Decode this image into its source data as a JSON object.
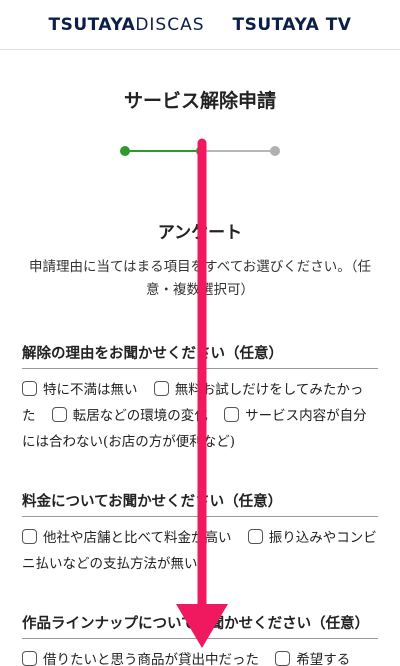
{
  "header": {
    "logo_discas_bold": "TSUTAYA",
    "logo_discas_thin": "DISCAS",
    "logo_tv": "TSUTAYA TV"
  },
  "page": {
    "title": "サービス解除申請"
  },
  "stepper": {
    "current_step": 2,
    "total_steps": 3,
    "colors": {
      "done": "#2e9a2e",
      "todo": "#b0b0b0"
    }
  },
  "survey": {
    "heading": "アンケート",
    "description": "申請理由に当てはまる項目をすべてお選びください。（任意・複数選択可）"
  },
  "sections": [
    {
      "title": "解除の理由をお聞かせください（任意）",
      "options": [
        "特に不満は無い",
        "無料お試しだけをしてみたかった",
        "転居などの環境の変化",
        "サービス内容が自分には合わない(お店の方が便利など)"
      ]
    },
    {
      "title": "料金についてお聞かせください（任意）",
      "options": [
        "他社や店舗と比べて料金が高い",
        "振り込みやコンビニ払いなどの支払方法が無い"
      ]
    },
    {
      "title": "作品ラインナップについてお聞かせください（任意）",
      "options": [
        "借りたいと思う商品が貸出中だった",
        "希望する"
      ]
    }
  ],
  "overlay": {
    "gesture": "swipe-down-arrow",
    "color": "#f0195f"
  }
}
